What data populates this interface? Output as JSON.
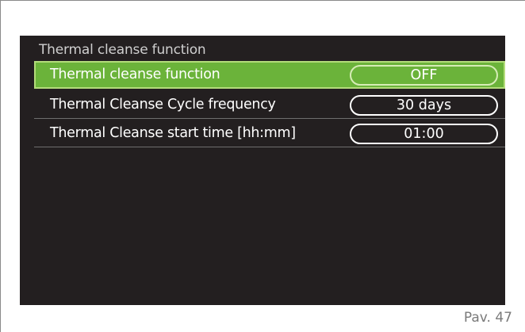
{
  "section_title": "Thermal cleanse function",
  "rows": [
    {
      "label": "Thermal cleanse function",
      "value": "OFF"
    },
    {
      "label": "Thermal Cleanse Cycle frequency",
      "value": "30 days"
    },
    {
      "label": "Thermal Cleanse start time [hh:mm]",
      "value": "01:00"
    }
  ],
  "selected_row_color": "#6bb33a",
  "footer": "Pav. 47"
}
